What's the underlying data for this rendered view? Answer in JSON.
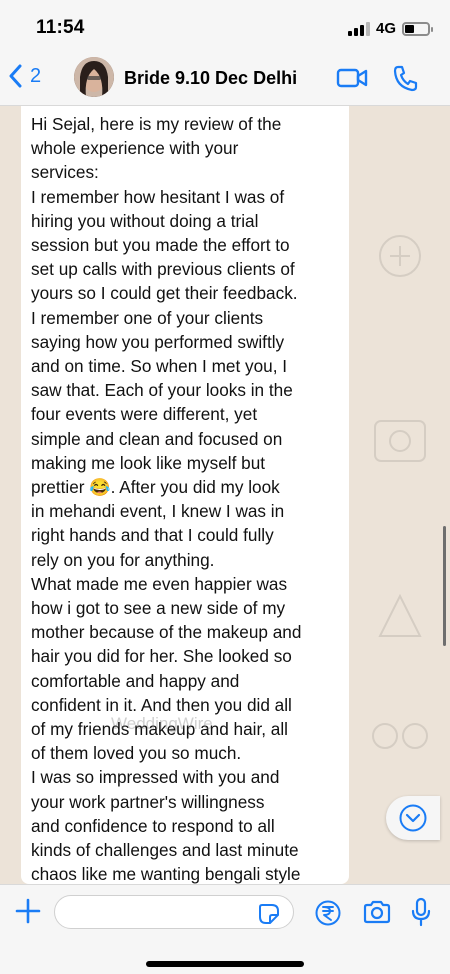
{
  "status_bar": {
    "time": "11:54",
    "network": "4G"
  },
  "header": {
    "back_count": "2",
    "title": "Bride 9.10 Dec Delhi",
    "accent": "#1a7cf5"
  },
  "message": {
    "lines": [
      "Hi Sejal, here is my review of the",
      "whole experience with your",
      "services:",
      "I remember how hesitant I was of",
      "hiring you without doing a trial",
      "session but you made the effort to",
      "set up calls with previous clients of",
      "yours so I could get their feedback.",
      "I remember one of your clients",
      "saying how you performed swiftly",
      "and on time. So when I met you, I",
      "saw that. Each of your looks in the",
      "four events were different,  yet",
      "simple and clean and focused on",
      "making me look like myself but",
      "prettier 😂.  After you did my look",
      "in mehandi event, I knew I was in",
      "right hands and that I could fully",
      "rely on you for anything.",
      "What made me even happier  was",
      "how i got to see a new side of my",
      "mother because of the makeup and",
      "hair you did for her. She looked so",
      "comfortable and happy and",
      "confident in it. And then you did all",
      "of my friends makeup and hair, all",
      "of them loved you so much.",
      "I was so impressed with you and",
      "your work partner's willingness",
      "and confidence to respond to all",
      "kinds of challenges and last minute",
      "chaos like me wanting bengali style"
    ],
    "watermark": "WeddingWire"
  },
  "icons": {
    "back": "chevron-left-icon",
    "video": "video-camera-icon",
    "call": "phone-icon",
    "scroll_down": "chevron-down-circle-icon",
    "plus": "plus-icon",
    "sticker": "sticker-icon",
    "payment": "rupee-icon",
    "camera": "camera-icon",
    "mic": "microphone-icon"
  }
}
